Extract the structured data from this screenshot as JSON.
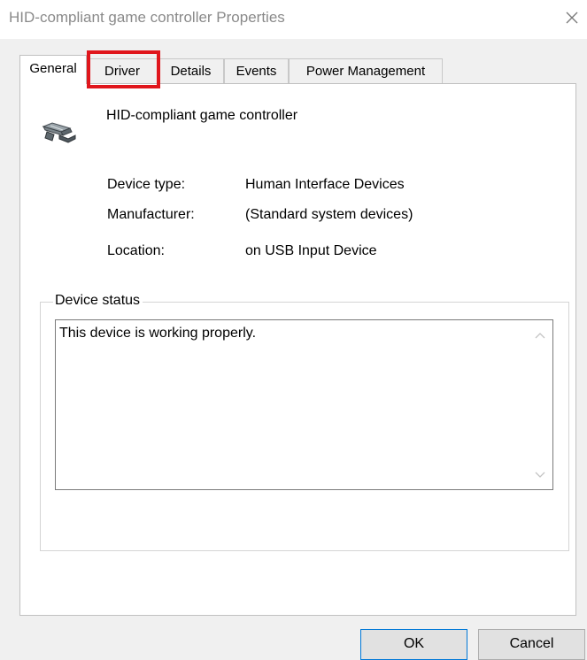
{
  "window": {
    "title": "HID-compliant game controller Properties",
    "close_glyph": "×"
  },
  "tabs": [
    {
      "label": "General",
      "active": true
    },
    {
      "label": "Driver",
      "active": false,
      "highlighted": true
    },
    {
      "label": "Details",
      "active": false
    },
    {
      "label": "Events",
      "active": false
    },
    {
      "label": "Power Management",
      "active": false
    }
  ],
  "device": {
    "icon": "game-controller-icon",
    "name": "HID-compliant game controller",
    "properties": [
      {
        "label": "Device type:",
        "value": "Human Interface Devices"
      },
      {
        "label": "Manufacturer:",
        "value": "(Standard system devices)"
      },
      {
        "label": "Location:",
        "value": "on USB Input Device"
      }
    ]
  },
  "status": {
    "legend": "Device status",
    "text": "This device is working properly."
  },
  "buttons": {
    "ok": "OK",
    "cancel": "Cancel"
  },
  "colors": {
    "highlight": "#e0161c",
    "default_button_border": "#0078d7"
  }
}
